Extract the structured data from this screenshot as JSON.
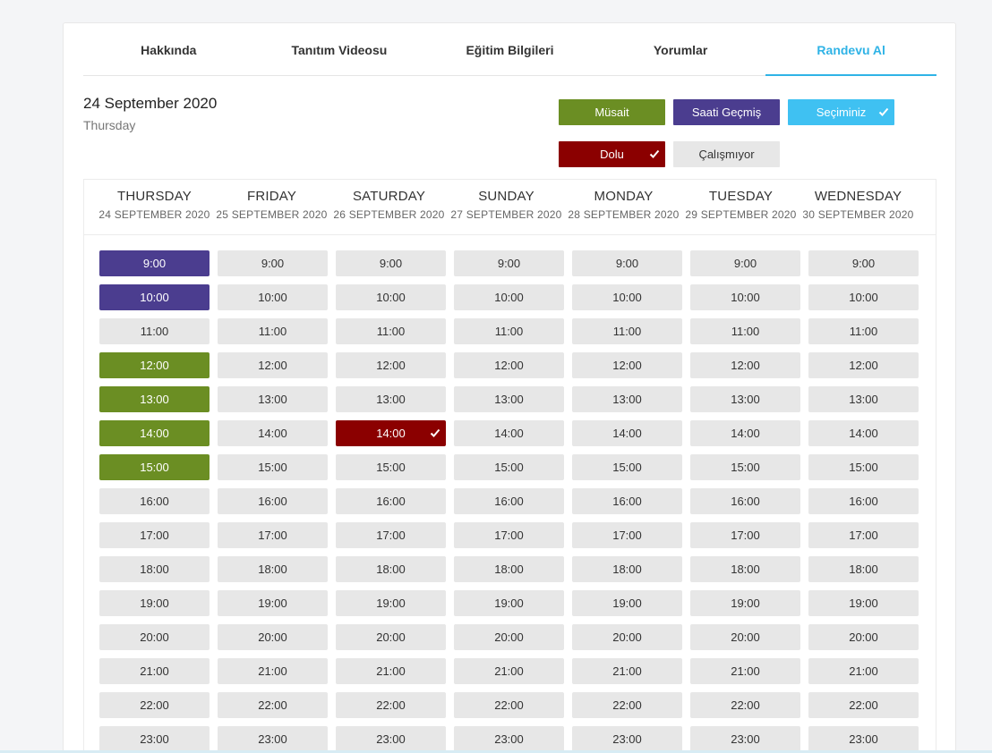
{
  "tabs": [
    {
      "label": "Hakkında",
      "active": false
    },
    {
      "label": "Tanıtım Videosu",
      "active": false
    },
    {
      "label": "Eğitim Bilgileri",
      "active": false
    },
    {
      "label": "Yorumlar",
      "active": false
    },
    {
      "label": "Randevu Al",
      "active": true
    }
  ],
  "selected_date": {
    "date": "24 September 2020",
    "weekday": "Thursday"
  },
  "legend": {
    "musait": {
      "label": "Müsait",
      "color": "#6b8e23"
    },
    "gecmis": {
      "label": "Saati Geçmiş",
      "color": "#4b3d8f"
    },
    "seciminiz": {
      "label": "Seçiminiz",
      "color": "#3fc1f2",
      "checked": true
    },
    "dolu": {
      "label": "Dolu",
      "color": "#8b0000",
      "checked": true
    },
    "calismiyor": {
      "label": "Çalışmıyor",
      "color": "#e7e7e7"
    }
  },
  "days": [
    {
      "name": "THURSDAY",
      "date": "24 SEPTEMBER 2020"
    },
    {
      "name": "FRIDAY",
      "date": "25 SEPTEMBER 2020"
    },
    {
      "name": "SATURDAY",
      "date": "26 SEPTEMBER 2020"
    },
    {
      "name": "SUNDAY",
      "date": "27 SEPTEMBER 2020"
    },
    {
      "name": "MONDAY",
      "date": "28 SEPTEMBER 2020"
    },
    {
      "name": "TUESDAY",
      "date": "29 SEPTEMBER 2020"
    },
    {
      "name": "WEDNESDAY",
      "date": "30 SEPTEMBER 2020"
    }
  ],
  "times": [
    "9:00",
    "10:00",
    "11:00",
    "12:00",
    "13:00",
    "14:00",
    "15:00",
    "16:00",
    "17:00",
    "18:00",
    "19:00",
    "20:00",
    "21:00",
    "22:00",
    "23:00"
  ],
  "slot_states": {
    "0": {
      "9:00": "gecmis",
      "10:00": "gecmis",
      "12:00": "musait",
      "13:00": "musait",
      "14:00": "musait",
      "15:00": "musait"
    },
    "2": {
      "14:00": "dolu"
    }
  }
}
